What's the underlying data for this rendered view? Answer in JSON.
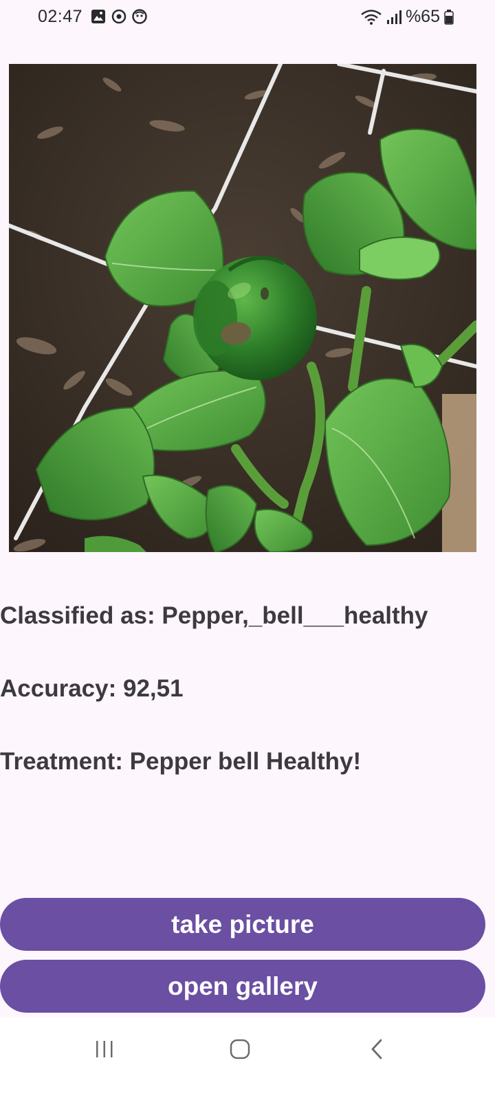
{
  "status_bar": {
    "time": "02:47",
    "battery_text": "%65",
    "left_icons": [
      "gallery-notification-icon",
      "sync-notification-icon",
      "face-notification-icon"
    ],
    "right_icons": [
      "wifi-icon",
      "signal-icon",
      "battery-icon"
    ]
  },
  "photo": {
    "description_icon": "plant-photo"
  },
  "result": {
    "classified": "Classified as: Pepper,_bell___healthy",
    "accuracy": "Accuracy: 92,51",
    "treatment": "Treatment: Pepper bell Healthy!"
  },
  "buttons": {
    "take_picture": "take picture",
    "open_gallery": "open gallery"
  },
  "nav_bar": {
    "icons": [
      "recent-apps-icon",
      "home-icon",
      "back-icon"
    ]
  },
  "colors": {
    "background": "#fdf6fd",
    "button": "#6a4fa3",
    "text": "#3d3a3f"
  }
}
